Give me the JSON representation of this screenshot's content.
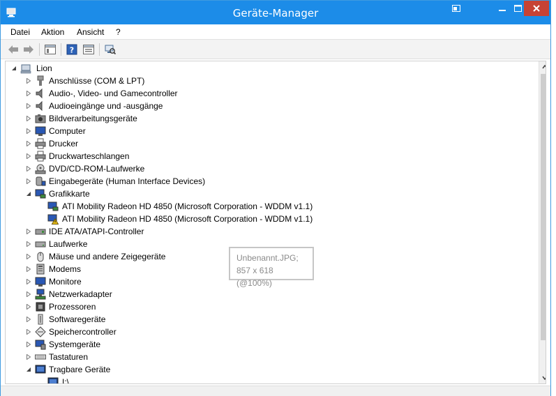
{
  "window": {
    "title": "Geräte-Manager",
    "accent_color": "#1c8ce8",
    "close_color": "#c74234"
  },
  "menu": {
    "items": [
      {
        "label": "Datei"
      },
      {
        "label": "Aktion"
      },
      {
        "label": "Ansicht"
      },
      {
        "label": "?"
      }
    ]
  },
  "toolbar": {
    "tools": [
      {
        "icon": "back-arrow-icon"
      },
      {
        "icon": "forward-arrow-icon"
      },
      {
        "icon": "show-hide-console-tree-icon"
      },
      {
        "icon": "help-icon"
      },
      {
        "icon": "properties-icon"
      },
      {
        "icon": "scan-hardware-icon"
      }
    ]
  },
  "tree": {
    "root": {
      "label": "Lion",
      "icon": "computer-root-icon",
      "expanded": true
    },
    "categories": [
      {
        "label": "Anschlüsse (COM & LPT)",
        "icon": "port-icon",
        "expanded": false
      },
      {
        "label": "Audio-, Video- und Gamecontroller",
        "icon": "speaker-icon",
        "expanded": false
      },
      {
        "label": "Audioeingänge und -ausgänge",
        "icon": "speaker-icon",
        "expanded": false
      },
      {
        "label": "Bildverarbeitungsgeräte",
        "icon": "camera-icon",
        "expanded": false
      },
      {
        "label": "Computer",
        "icon": "monitor-icon",
        "expanded": false
      },
      {
        "label": "Drucker",
        "icon": "printer-icon",
        "expanded": false
      },
      {
        "label": "Druckwarteschlangen",
        "icon": "printer-icon",
        "expanded": false
      },
      {
        "label": "DVD/CD-ROM-Laufwerke",
        "icon": "dvd-drive-icon",
        "expanded": false
      },
      {
        "label": "Eingabegeräte (Human Interface Devices)",
        "icon": "hid-icon",
        "expanded": false
      },
      {
        "label": "Grafikkarte",
        "icon": "display-adapter-icon",
        "expanded": true,
        "children": [
          {
            "label": "ATI Mobility Radeon HD 4850 (Microsoft Corporation - WDDM v1.1)",
            "icon": "display-adapter-icon"
          },
          {
            "label": "ATI Mobility Radeon HD 4850 (Microsoft Corporation - WDDM v1.1)",
            "icon": "display-adapter-warning-icon"
          }
        ]
      },
      {
        "label": "IDE ATA/ATAPI-Controller",
        "icon": "ide-controller-icon",
        "expanded": false
      },
      {
        "label": "Laufwerke",
        "icon": "disk-drive-icon",
        "expanded": false
      },
      {
        "label": "Mäuse und andere Zeigegeräte",
        "icon": "mouse-icon",
        "expanded": false
      },
      {
        "label": "Modems",
        "icon": "modem-icon",
        "expanded": false
      },
      {
        "label": "Monitore",
        "icon": "monitor-icon",
        "expanded": false
      },
      {
        "label": "Netzwerkadapter",
        "icon": "network-adapter-icon",
        "expanded": false
      },
      {
        "label": "Prozessoren",
        "icon": "processor-icon",
        "expanded": false
      },
      {
        "label": "Softwaregeräte",
        "icon": "software-device-icon",
        "expanded": false
      },
      {
        "label": "Speichercontroller",
        "icon": "storage-controller-icon",
        "expanded": false
      },
      {
        "label": "Systemgeräte",
        "icon": "system-device-icon",
        "expanded": false
      },
      {
        "label": "Tastaturen",
        "icon": "keyboard-icon",
        "expanded": false
      },
      {
        "label": "Tragbare Geräte",
        "icon": "portable-device-icon",
        "expanded": true,
        "children": [
          {
            "label": "I:\\",
            "icon": "portable-device-icon"
          }
        ]
      }
    ]
  },
  "tooltip": {
    "line1": "Unbenannt.JPG;",
    "line2": "857 x 618 (@100%)"
  }
}
